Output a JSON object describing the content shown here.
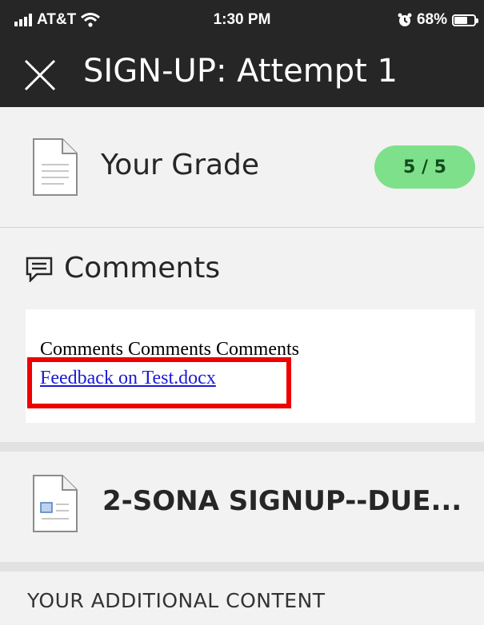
{
  "status_bar": {
    "carrier": "AT&T",
    "time": "1:30 PM",
    "battery": "68%",
    "battery_level": 0.68
  },
  "header": {
    "title": "SIGN-UP: Attempt 1",
    "close_icon": "close-icon"
  },
  "grade": {
    "label": "Your Grade",
    "value": "5 / 5",
    "icon": "document-icon",
    "badge_color": "#7fe08b"
  },
  "comments": {
    "heading": "Comments",
    "icon": "comment-icon",
    "text": "Comments Comments Comments",
    "link_text": "Feedback on Test.docx"
  },
  "attachment": {
    "name": "2-SONA SIGNUP--DUE...",
    "icon": "document-image-icon"
  },
  "additional": {
    "label": "YOUR ADDITIONAL CONTENT"
  },
  "colors": {
    "header_bg": "#262626",
    "link": "#1a1ad6",
    "highlight": "#ee0000"
  }
}
